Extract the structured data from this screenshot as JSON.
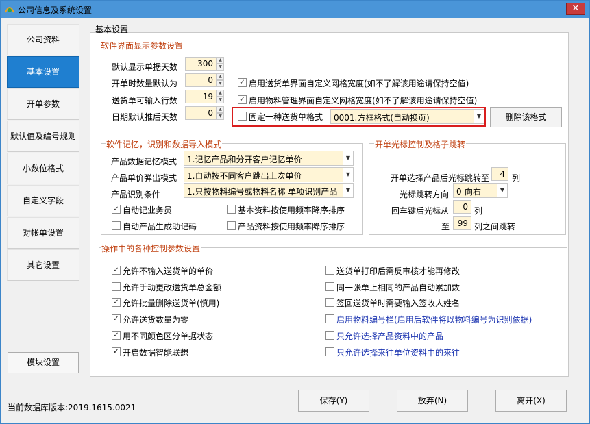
{
  "window": {
    "title": "公司信息及系统设置",
    "close_label": "✕"
  },
  "sidebar": {
    "items": [
      {
        "label": "公司资料",
        "active": false
      },
      {
        "label": "基本设置",
        "active": true
      },
      {
        "label": "开单参数",
        "active": false
      },
      {
        "label": "默认值及编号规则",
        "active": false
      },
      {
        "label": "小数位格式",
        "active": false
      },
      {
        "label": "自定义字段",
        "active": false
      },
      {
        "label": "对帐单设置",
        "active": false
      },
      {
        "label": "其它设置",
        "active": false
      }
    ],
    "module_button": "模块设置"
  },
  "main": {
    "title": "基本设置"
  },
  "display_group": {
    "title": "软件界面显示参数设置",
    "default_days_label": "默认显示单据天数",
    "default_days_value": "300",
    "qty_default_label": "开单时数量默认为",
    "qty_default_value": "0",
    "rows_label": "送货单可输入行数",
    "rows_value": "19",
    "date_delay_label": "日期默认推后天数",
    "date_delay_value": "0",
    "custom_grid_delivery": {
      "label": "启用送货单界面自定义网格宽度(如不了解该用途请保持空值)",
      "checked": true
    },
    "custom_grid_material": {
      "label": "启用物料管理界面自定义网格宽度(如不了解该用途请保持空值)",
      "checked": true
    },
    "fixed_format": {
      "label": "固定一种送货单格式",
      "checked": false,
      "value": "0001.方框格式(自动换页)"
    },
    "delete_format_button": "删除该格式"
  },
  "memory_group": {
    "title": "软件记忆，识别和数据导入模式",
    "mode_label": "产品数据记忆模式",
    "mode_value": "1.记忆产品和分开客户记忆单价",
    "price_label": "产品单价弹出模式",
    "price_value": "1.自动按不同客户跳出上次单价",
    "ident_label": "产品识别条件",
    "ident_value": "1.只按物料编号或物料名称 单项识别产品",
    "remember_salesman": {
      "label": "自动记业务员",
      "checked": true
    },
    "basic_sort": {
      "label": "基本资料按使用频率降序排序",
      "checked": false
    },
    "auto_code": {
      "label": "自动产品生成助记码",
      "checked": false
    },
    "product_sort": {
      "label": "产品资料按使用频率降序排序",
      "checked": false
    }
  },
  "cursor_group": {
    "title": "开单光标控制及格子跳转",
    "jump_to_label": "开单选择产品后光标跳转至",
    "jump_to_value": "4",
    "jump_to_unit": "列",
    "direction_label": "光标跳转方向",
    "direction_value": "0-向右",
    "enter_from_label": "回车键后光标从",
    "enter_from_value": "0",
    "enter_from_unit": "列",
    "to_label": "至",
    "to_value": "99",
    "to_unit": "列之间跳转"
  },
  "control_group": {
    "title": "操作中的各种控制参数设置",
    "left": [
      {
        "label": "允许不输入送货单的单价",
        "checked": true
      },
      {
        "label": "允许手动更改送货单总金额",
        "checked": false
      },
      {
        "label": "允许批量删除送货单(慎用)",
        "checked": true
      },
      {
        "label": "允许送货数量为零",
        "checked": true
      },
      {
        "label": "用不同颜色区分单据状态",
        "checked": true
      },
      {
        "label": "开启数据智能联想",
        "checked": true
      }
    ],
    "right": [
      {
        "label": "送货单打印后需反审核才能再修改",
        "checked": false
      },
      {
        "label": "同一张单上相同的产品自动累加数",
        "checked": false
      },
      {
        "label": "签回送货单时需要输入签收人姓名",
        "checked": false
      },
      {
        "label": "启用物料编号栏(启用后软件将以物料编号为识别依据)",
        "checked": false
      },
      {
        "label": "只允许选择产品资料中的产品",
        "checked": false
      },
      {
        "label": "只允许选择来往单位资料中的来往",
        "checked": false
      }
    ]
  },
  "footer": {
    "db_version": "当前数据库版本:2019.1615.0021",
    "save": "保存(Y)",
    "cancel": "放弃(N)",
    "exit": "离开(X)"
  },
  "glyphs": {
    "check": "✓",
    "up": "▲",
    "down": "▼"
  },
  "colors": {
    "active_tab": "#1f7fd0",
    "group_title": "#c04010",
    "highlight": "#d91e1e",
    "input_bg": "#fff5d6",
    "link_text": "#1a33b0"
  }
}
